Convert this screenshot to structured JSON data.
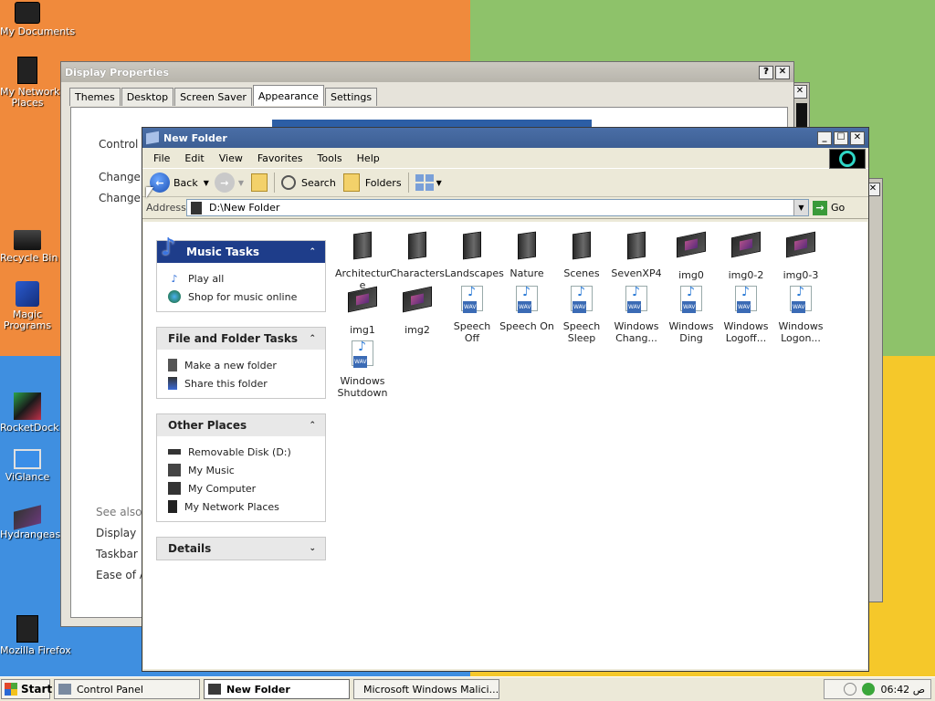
{
  "desktop": {
    "icons": [
      "My Documents",
      "My Network Places",
      "Recycle Bin",
      "Magic Programs",
      "RocketDock",
      "ViGlance",
      "Hydrangeas",
      "Mozilla Firefox"
    ],
    "icon_lines": [
      [
        "My Documents"
      ],
      [
        "My Network",
        "Places"
      ],
      [
        "Recycle Bin"
      ],
      [
        "Magic",
        "Programs"
      ],
      [
        "RocketDock"
      ],
      [
        "ViGlance"
      ],
      [
        "Hydrangeas"
      ],
      [
        "Mozilla Firefox"
      ]
    ]
  },
  "display_properties": {
    "title": "Display Properties",
    "tabs": [
      "Themes",
      "Desktop",
      "Screen Saver",
      "Appearance",
      "Settings"
    ],
    "active_tab": "Appearance",
    "side_links": [
      "Control P",
      "Change d",
      "Change r"
    ],
    "see_also": "See also",
    "see_also_links": [
      "Display",
      "Taskbar",
      "Ease of A"
    ],
    "help": "?",
    "close": "✕"
  },
  "explorer": {
    "title": "New Folder",
    "controls": [
      "_",
      "☐",
      "✕"
    ],
    "menu": [
      "File",
      "Edit",
      "View",
      "Favorites",
      "Tools",
      "Help"
    ],
    "toolbar": {
      "back": "Back",
      "search": "Search",
      "folders": "Folders"
    },
    "address": {
      "label": "Address",
      "path": "D:\\New Folder",
      "go": "Go"
    },
    "task_groups": [
      {
        "title": "Music Tasks",
        "items": [
          "Play all",
          "Shop for music online"
        ]
      },
      {
        "title": "File and Folder Tasks",
        "items": [
          "Make a new folder",
          "Share this folder"
        ]
      },
      {
        "title": "Other Places",
        "items": [
          "Removable Disk (D:)",
          "My Music",
          "My Computer",
          "My Network Places"
        ]
      },
      {
        "title": "Details",
        "items": []
      }
    ],
    "files": [
      {
        "name": "Architectur e",
        "kind": "folder"
      },
      {
        "name": "Characters",
        "kind": "folder"
      },
      {
        "name": "Landscapes",
        "kind": "folder"
      },
      {
        "name": "Nature",
        "kind": "folder"
      },
      {
        "name": "Scenes",
        "kind": "folder"
      },
      {
        "name": "SevenXP4",
        "kind": "folder"
      },
      {
        "name": "img0",
        "kind": "image"
      },
      {
        "name": "img0-2",
        "kind": "image"
      },
      {
        "name": "img0-3",
        "kind": "image"
      },
      {
        "name": "img1",
        "kind": "image"
      },
      {
        "name": "img2",
        "kind": "image"
      },
      {
        "name": "Speech Off",
        "kind": "wav"
      },
      {
        "name": "Speech On",
        "kind": "wav"
      },
      {
        "name": "Speech Sleep",
        "kind": "wav"
      },
      {
        "name": "Windows Chang...",
        "kind": "wav"
      },
      {
        "name": "Windows Ding",
        "kind": "wav"
      },
      {
        "name": "Windows Logoff...",
        "kind": "wav"
      },
      {
        "name": "Windows Logon...",
        "kind": "wav"
      },
      {
        "name": "Windows Shutdown",
        "kind": "wav"
      }
    ]
  },
  "taskbar": {
    "start": "Start",
    "buttons": [
      "Control Panel",
      "New Folder",
      "Microsoft Windows Malici..."
    ],
    "active": "New Folder",
    "clock": "06:42 ص"
  },
  "colors": {
    "explorer_title": "#3d5f94",
    "music_header": "#1e3d8a",
    "accent_blue": "#3a74e0"
  }
}
